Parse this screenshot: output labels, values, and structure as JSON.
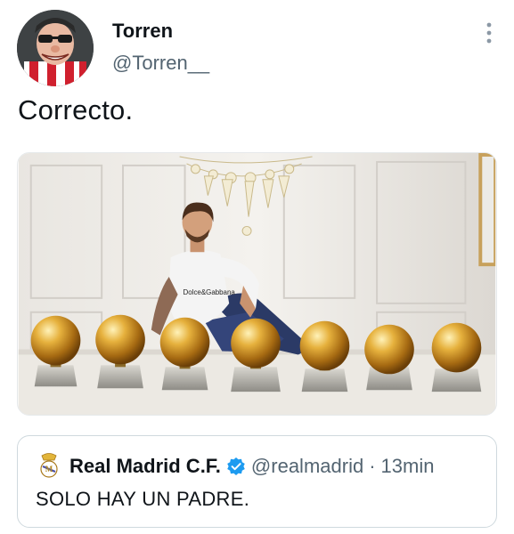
{
  "author": {
    "display_name": "Torren",
    "handle": "@Torren__"
  },
  "tweet": {
    "text": "Correcto."
  },
  "media": {
    "shirt_print": "Dolce&Gabbana"
  },
  "quoted_tweet": {
    "display_name": "Real Madrid C.F.",
    "handle": "@realmadrid",
    "separator": "·",
    "time": "13min",
    "text": "SOLO HAY UN PADRE."
  },
  "icons": {
    "more": "more-vertical-icon",
    "verified": "verified-badge-icon",
    "quote_avatar": "real-madrid-crest-icon"
  },
  "colors": {
    "text": "#0f1419",
    "secondary": "#536471",
    "verified": "#1d9bf0",
    "border": "#cfd9de"
  }
}
